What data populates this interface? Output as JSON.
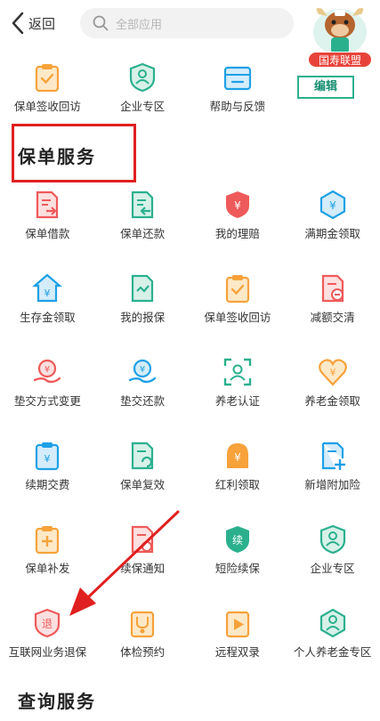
{
  "header": {
    "back_label": "返回",
    "search_placeholder": "全部应用",
    "badge_label": "国寿联盟"
  },
  "top_apps": [
    {
      "label": "保单签收回访",
      "icon": "clipboard-check-icon"
    },
    {
      "label": "企业专区",
      "icon": "people-shield-icon"
    },
    {
      "label": "帮助与反馈",
      "icon": "help-envelope-icon"
    }
  ],
  "edit_label": "编辑",
  "sections": {
    "policy_service": "保单服务",
    "query_service": "查询服务"
  },
  "policy_apps": [
    {
      "label": "保单借款",
      "icon": "policy-loan-icon"
    },
    {
      "label": "保单还款",
      "icon": "policy-repay-icon"
    },
    {
      "label": "我的理赔",
      "icon": "my-claim-icon"
    },
    {
      "label": "满期金领取",
      "icon": "maturity-benefit-icon"
    },
    {
      "label": "生存金领取",
      "icon": "survival-benefit-icon"
    },
    {
      "label": "我的报保",
      "icon": "my-report-icon"
    },
    {
      "label": "保单签收回访",
      "icon": "clipboard-check-icon"
    },
    {
      "label": "减额交清",
      "icon": "reduced-paidup-icon"
    },
    {
      "label": "垫交方式变更",
      "icon": "advance-payment-icon"
    },
    {
      "label": "垫交还款",
      "icon": "advance-repay-icon"
    },
    {
      "label": "养老认证",
      "icon": "pension-auth-icon"
    },
    {
      "label": "养老金领取",
      "icon": "pension-collect-icon"
    },
    {
      "label": "续期交费",
      "icon": "renewal-payment-icon"
    },
    {
      "label": "保单复效",
      "icon": "policy-reinstate-icon"
    },
    {
      "label": "红利领取",
      "icon": "dividend-collect-icon"
    },
    {
      "label": "新增附加险",
      "icon": "add-rider-icon"
    },
    {
      "label": "保单补发",
      "icon": "policy-reissue-icon"
    },
    {
      "label": "续保通知",
      "icon": "renewal-notice-icon"
    },
    {
      "label": "短险续保",
      "icon": "short-term-renew-icon"
    },
    {
      "label": "企业专区",
      "icon": "people-shield-icon"
    },
    {
      "label": "互联网业务退保",
      "icon": "internet-surrender-icon"
    },
    {
      "label": "体检预约",
      "icon": "medical-exam-icon"
    },
    {
      "label": "远程双录",
      "icon": "remote-record-icon"
    },
    {
      "label": "个人养老金专区",
      "icon": "personal-pension-icon"
    }
  ],
  "colors": {
    "orange": "#f7a23b",
    "teal": "#2bb08e",
    "blue": "#1ea0e6",
    "red": "#ee5a5a",
    "annotation_red": "#e02020"
  }
}
